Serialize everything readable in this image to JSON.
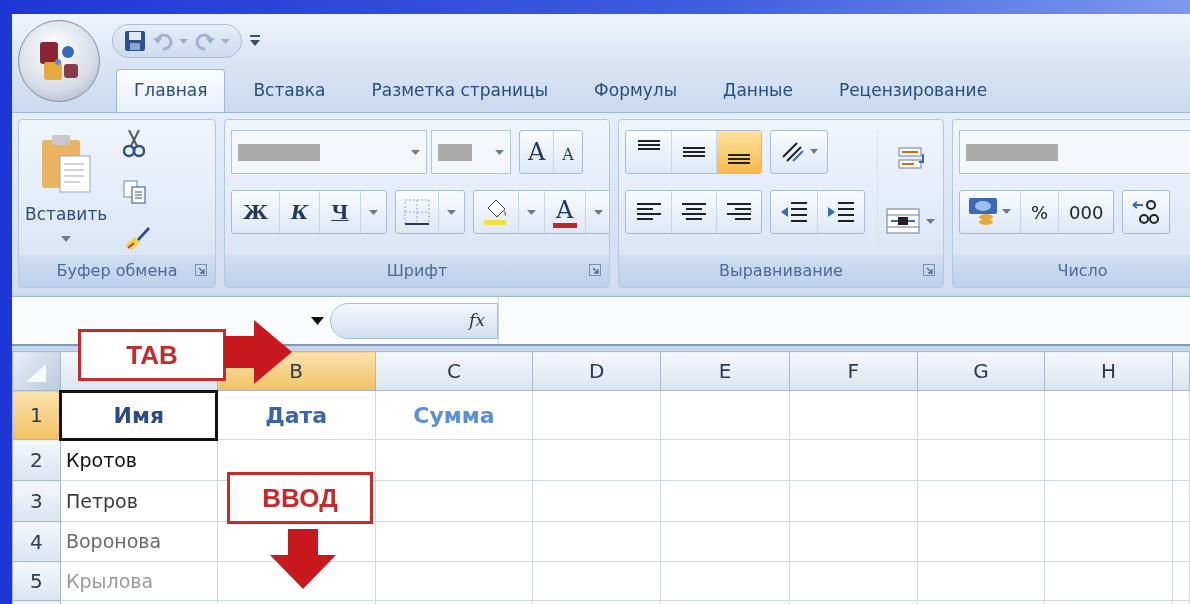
{
  "tabs": [
    {
      "label": "Главная",
      "selected": true
    },
    {
      "label": "Вставка",
      "selected": false
    },
    {
      "label": "Разметка страницы",
      "selected": false
    },
    {
      "label": "Формулы",
      "selected": false
    },
    {
      "label": "Данные",
      "selected": false
    },
    {
      "label": "Рецензирование",
      "selected": false
    }
  ],
  "ribbon_groups": [
    {
      "kind": "clipboard",
      "title": "Буфер обмена",
      "paste_label": "Вставить"
    },
    {
      "kind": "font",
      "title": "Шрифт",
      "grow_label": "A",
      "shrink_label": "A",
      "style_buttons": [
        "Ж",
        "К",
        "Ч"
      ],
      "font_color_label": "A"
    },
    {
      "kind": "alignment",
      "title": "Выравнивание",
      "vertical_buttons": [
        {
          "selected": false
        },
        {
          "selected": false
        },
        {
          "selected": true
        }
      ],
      "horizontal_buttons": [
        {
          "selected": false
        },
        {
          "selected": false
        },
        {
          "selected": false
        }
      ]
    },
    {
      "kind": "number",
      "title": "Число",
      "format_buttons": [
        "%",
        "000"
      ]
    }
  ],
  "formula_bar": {
    "function_label": "fx"
  },
  "sheet": {
    "columns": [
      {
        "selected": false
      },
      {
        "label": "B",
        "selected": true
      },
      {
        "label": "C",
        "selected": false
      },
      {
        "label": "D",
        "selected": false
      },
      {
        "label": "E",
        "selected": false
      },
      {
        "label": "F",
        "selected": false
      },
      {
        "label": "G",
        "selected": false
      },
      {
        "label": "H",
        "selected": false
      }
    ],
    "rows": [
      {
        "label": "1",
        "selected": true,
        "cells": [
          {
            "text": "Имя",
            "bold": true,
            "active": true,
            "color": "#2c4a86"
          },
          {
            "text": "Дата",
            "bold": true,
            "active": false,
            "color": "#3b64ad"
          },
          {
            "text": "Сумма",
            "bold": true,
            "active": false,
            "color": "#5b8fd6"
          }
        ]
      },
      {
        "label": "2",
        "selected": false,
        "cells": [
          {
            "text": "Кротов",
            "bold": false,
            "active": false,
            "color": "#111111"
          }
        ]
      },
      {
        "label": "3",
        "selected": false,
        "cells": [
          {
            "text": "Петров",
            "bold": false,
            "active": false,
            "color": "#3a3a3a"
          }
        ]
      },
      {
        "label": "4",
        "selected": false,
        "cells": [
          {
            "text": "Воронова",
            "bold": false,
            "active": false,
            "color": "#6a6a6a"
          }
        ]
      },
      {
        "label": "5",
        "selected": false,
        "cells": [
          {
            "text": "Крылова",
            "bold": false,
            "active": false,
            "color": "#9a9a9a"
          }
        ]
      }
    ]
  },
  "callouts": [
    {
      "text": "TAB",
      "kind": "right"
    },
    {
      "text": "ВВОД",
      "kind": "down"
    }
  ]
}
